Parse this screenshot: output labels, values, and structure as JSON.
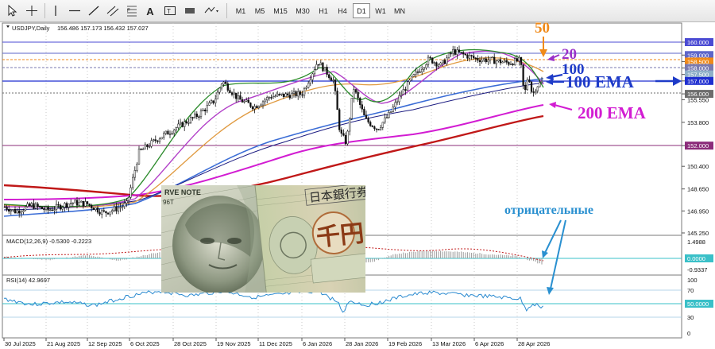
{
  "toolbar": {
    "timeframes": [
      "M1",
      "M5",
      "M15",
      "M30",
      "H1",
      "H4",
      "D1",
      "W1",
      "MN"
    ],
    "active": "D1"
  },
  "header": {
    "symbol": "USDJPY,Daily",
    "ohlc": "156.486 157.173 156.432 157.027"
  },
  "price_axis": [
    {
      "label": "160.000",
      "value": 160.0,
      "tag": "#4b4bd3"
    },
    {
      "label": "159.000",
      "value": 159.0,
      "tag": "#5e66c9"
    },
    {
      "label": "158.500",
      "value": 158.5,
      "tag": "#f08a19"
    },
    {
      "label": "158.000",
      "value": 158.0,
      "tag": "#7a7ab0"
    },
    {
      "label": "157.500",
      "value": 157.5,
      "tag": "#8fb0c8"
    },
    {
      "label": "157.000",
      "value": 157.0,
      "tag": "#1f2fd0"
    },
    {
      "label": "156.000",
      "value": 156.0,
      "tag": "#6d6d6d"
    },
    {
      "label": "155.550",
      "value": 155.55,
      "tag": null
    },
    {
      "label": "153.800",
      "value": 153.8,
      "tag": null
    },
    {
      "label": "152.000",
      "value": 152.0,
      "tag": "#8b2c7a"
    },
    {
      "label": "150.400",
      "value": 150.4,
      "tag": null
    },
    {
      "label": "148.650",
      "value": 148.65,
      "tag": null
    },
    {
      "label": "146.950",
      "value": 146.95,
      "tag": null
    },
    {
      "label": "145.250",
      "value": 145.25,
      "tag": null
    }
  ],
  "macd": {
    "label": "MACD(12,26,9) -0.5300 -0.2223",
    "axis": [
      "1.4988",
      "0.0000",
      "-0.9337"
    ]
  },
  "rsi": {
    "label": "RSI(14) 42.9697",
    "axis": [
      "100",
      "70",
      "50.0000",
      "30",
      "0"
    ]
  },
  "x_axis": [
    "30 Jul 2025",
    "21 Aug 2025",
    "12 Sep 2025",
    "6 Oct 2025",
    "28 Oct 2025",
    "19 Nov 2025",
    "11 Dec 2025",
    "6 Jan 2026",
    "28 Jan 2026",
    "19 Feb 2026",
    "13 Mar 2026",
    "6 Apr 2026",
    "28 Apr 2026"
  ],
  "annotations": {
    "ema50": "50",
    "ema20": "20",
    "ema100_num": "100",
    "ema100": "100 EMA",
    "ema200": "200 EMA",
    "negative": "отрицательные"
  },
  "photo": {
    "banknote_text": "日本銀行券",
    "kanji": "千円",
    "note_text": "RVE NOTE",
    "serial": "96T"
  },
  "colors": {
    "candle": "#111111",
    "ema20": "#2a8a2a",
    "ema50": "#e09a40",
    "ema100": "#3b6dd6",
    "ema200": "#c01818",
    "magenta": "#d21cd2",
    "purple": "#9a30c8",
    "annot_blue": "#1e3bc8",
    "orange_label": "#f08a19",
    "cyan_label": "#2a90d0"
  }
}
